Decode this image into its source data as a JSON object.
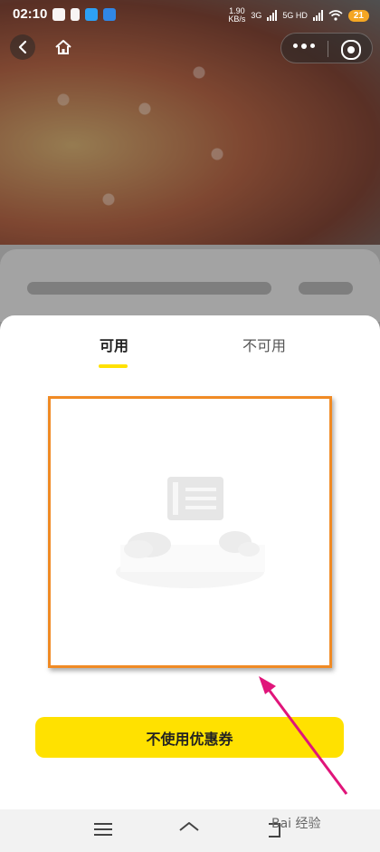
{
  "status_bar": {
    "time": "02:10",
    "net_speed": "1.90",
    "net_unit": "KB/s",
    "net_type_1": "3G",
    "net_type_2": "5G HD",
    "battery": "21"
  },
  "tabs": [
    {
      "label": "可用",
      "active": true
    },
    {
      "label": "不可用",
      "active": false
    }
  ],
  "primary_button": {
    "label": "不使用优惠券"
  },
  "colors": {
    "accent": "#ffe100",
    "highlight_frame": "#f08a24",
    "annotation_arrow": "#e0157a"
  },
  "icons": [
    "back-icon",
    "home-icon",
    "more-icon",
    "target-icon",
    "menu-icon",
    "system-home-icon",
    "system-back-icon"
  ],
  "watermark": "Bai 经验"
}
